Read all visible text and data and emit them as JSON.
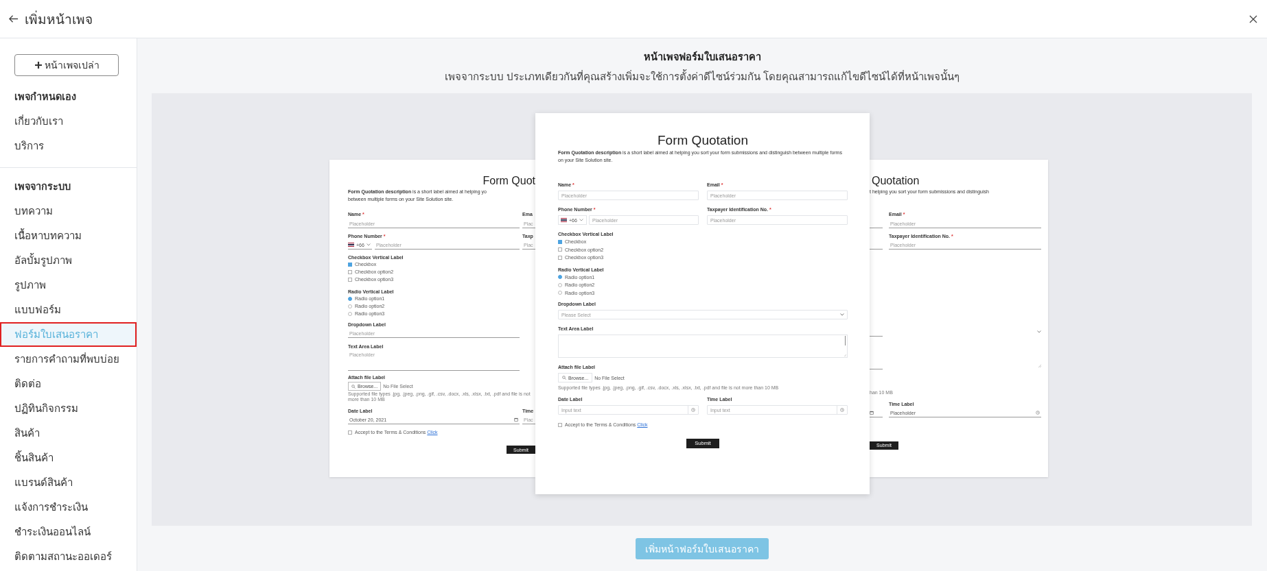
{
  "header": {
    "title": "เพิ่มหน้าเพจ"
  },
  "sidebar": {
    "new_page_button": "หน้าเพจเปล่า",
    "sections": [
      {
        "title": "เพจกำหนดเอง",
        "items": [
          {
            "label": "เกี่ยวกับเรา",
            "selected": false
          },
          {
            "label": "บริการ",
            "selected": false
          }
        ]
      },
      {
        "title": "เพจจากระบบ",
        "items": [
          {
            "label": "บทความ",
            "selected": false
          },
          {
            "label": "เนื้อหาบทความ",
            "selected": false
          },
          {
            "label": "อัลบั้มรูปภาพ",
            "selected": false
          },
          {
            "label": "รูปภาพ",
            "selected": false
          },
          {
            "label": "แบบฟอร์ม",
            "selected": false
          },
          {
            "label": "ฟอร์มใบเสนอราคา",
            "selected": true
          },
          {
            "label": "รายการคำถามที่พบบ่อย",
            "selected": false
          },
          {
            "label": "ติดต่อ",
            "selected": false
          },
          {
            "label": "ปฏิทินกิจกรรม",
            "selected": false
          },
          {
            "label": "สินค้า",
            "selected": false
          },
          {
            "label": "ชิ้นสินค้า",
            "selected": false
          },
          {
            "label": "แบรนด์สินค้า",
            "selected": false
          },
          {
            "label": "แจ้งการชำระเงิน",
            "selected": false
          },
          {
            "label": "ชำระเงินออนไลน์",
            "selected": false
          },
          {
            "label": "ติดตามสถานะออเดอร์",
            "selected": false
          }
        ]
      }
    ]
  },
  "main": {
    "title": "หน้าเพจฟอร์มใบเสนอราคา",
    "subtitle": "เพจจากระบบ ประเภทเดียวกันที่คุณสร้างเพิ่มจะใช้การตั้งค่าดีไซน์ร่วมกัน โดยคุณสามารถแก้ไขดีไซน์ได้ที่หน้าเพจนั้นๆ",
    "preview": {
      "left_card": {
        "title": "Form Quot",
        "description_lines": [
          "**Form Quotation description**  is a short label aimed at helping yo",
          "between multiple forms on your Site Solution site."
        ],
        "name": {
          "label": "Name",
          "mark": "*",
          "placeholder": "Placeholder"
        },
        "name_stub": {
          "label": "Ema",
          "placeholder": "Plac"
        },
        "phone": {
          "label": "Phone Number",
          "mark": "*",
          "country_code": "+66",
          "placeholder": "Placeholder"
        },
        "phone_stub": {
          "label": "Taxp",
          "placeholder": "Plac"
        },
        "checkboxes": {
          "label": "Checkbox Vertical Label",
          "options": [
            {
              "label": "Checkbox",
              "checked": true
            },
            {
              "label": "Checkbox option2",
              "checked": false
            },
            {
              "label": "Checkbox option3",
              "checked": false
            }
          ]
        },
        "radios": {
          "label": "Radio Vertical Label",
          "options": [
            {
              "label": "Radio option1",
              "selected": true
            },
            {
              "label": "Radio option2",
              "selected": false
            },
            {
              "label": "Radio option3",
              "selected": false
            }
          ]
        },
        "dropdown": {
          "label": "Dropdown Label",
          "placeholder": "Placeholder"
        },
        "textarea": {
          "label": "Text Area Label",
          "placeholder": "Placeholder"
        },
        "attach": {
          "label": "Attach file Label",
          "button": "Browse...",
          "status": "No File Select",
          "hint": "Supported file types .jpg, .jpeg, .png, .gif, .csv, .docx, .xls, .xlsx, .txt, .pdf and file is not more than 10 MB"
        },
        "date": {
          "label": "Date Label",
          "value": "October 20, 2021"
        },
        "date_stub": {
          "label": "Time",
          "placeholder": "Plac"
        },
        "terms": {
          "text": "Accept to the Terms & Conditions",
          "link": "Click",
          "checked": false
        },
        "submit": "Submit"
      },
      "center_card": {
        "title": "Form Quotation",
        "description": "**Form Quotation description**  is a short label aimed at helping you sort your form submissions and distinguish between multiple forms on your Site Solution site.",
        "name": {
          "label": "Name",
          "mark": "*",
          "placeholder": "Placeholder"
        },
        "email": {
          "label": "Email",
          "mark": "*",
          "placeholder": "Placeholder"
        },
        "phone": {
          "label": "Phone Number",
          "mark": "*",
          "country_code": "+66",
          "placeholder": "Placeholder"
        },
        "taxpayer": {
          "label": "Taxpayer Identification No.",
          "mark": "*",
          "placeholder": "Placeholder"
        },
        "checkboxes": {
          "label": "Checkbox Vertical Label",
          "options": [
            {
              "label": "Checkbox",
              "checked": true
            },
            {
              "label": "Checkbox option2",
              "checked": false
            },
            {
              "label": "Checkbox option3",
              "checked": false
            }
          ]
        },
        "radios": {
          "label": "Radio Vertical Label",
          "options": [
            {
              "label": "Radio option1",
              "selected": true
            },
            {
              "label": "Radio option2",
              "selected": false
            },
            {
              "label": "Radio option3",
              "selected": false
            }
          ]
        },
        "dropdown": {
          "label": "Dropdown Label",
          "placeholder": "Please Select"
        },
        "textarea": {
          "label": "Text Area Label"
        },
        "attach": {
          "label": "Attach file Label",
          "button": "Browse...",
          "status": "No File Select",
          "hint": "Supported file types .jpg, .jpeg, .png, .gif, .csv, .docx, .xls, .xlsx, .txt, .pdf and file is not more than 10 MB"
        },
        "date": {
          "label": "Date Label",
          "placeholder": "Input text"
        },
        "time": {
          "label": "Time Label",
          "placeholder": "Input text"
        },
        "terms": {
          "text": "Accept to the Terms & Conditions",
          "link": "Click",
          "checked": false
        },
        "submit": "Submit"
      },
      "right_card": {
        "title": "Quotation",
        "description": "t helping you sort your form submissions and distinguish",
        "email": {
          "label": "Email",
          "mark": "*",
          "placeholder": "Placeholder"
        },
        "taxpayer": {
          "label": "Taxpayer Identification No.",
          "mark": "*",
          "placeholder": "Placeholder"
        },
        "hint_end": "han 10 MB",
        "time": {
          "label": "Time Label",
          "placeholder": "Placeholder"
        },
        "submit": "Submit"
      }
    },
    "add_button": "เพิ่มหน้าฟอร์มใบเสนอราคา"
  }
}
